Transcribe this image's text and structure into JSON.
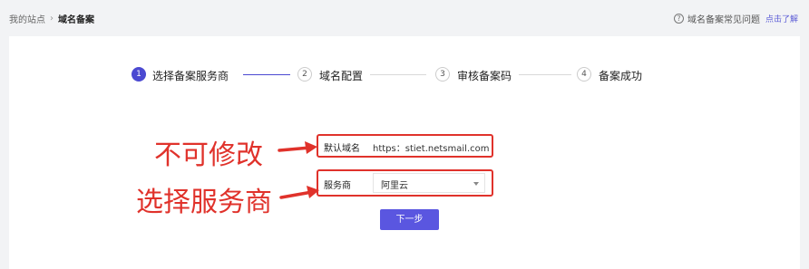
{
  "breadcrumb": {
    "parent": "我的站点",
    "separator": "›",
    "current": "域名备案"
  },
  "help": {
    "icon_glyph": "?",
    "text": "域名备案常见问题",
    "link": "点击了解"
  },
  "steps": [
    {
      "number": "1",
      "label": "选择备案服务商",
      "active": true
    },
    {
      "number": "2",
      "label": "域名配置",
      "active": false
    },
    {
      "number": "3",
      "label": "审核备案码",
      "active": false
    },
    {
      "number": "4",
      "label": "备案成功",
      "active": false
    }
  ],
  "form": {
    "domain_label": "默认域名",
    "domain_value": "https：stiet.netsmail.com",
    "provider_label": "服务商",
    "provider_value": "阿里云"
  },
  "annotations": {
    "not_editable": "不可修改",
    "select_provider": "选择服务商"
  },
  "next_button": "下一步",
  "colors": {
    "accent": "#4b49d1",
    "annotation_red": "#e0322b",
    "background": "#f2f3f5"
  }
}
